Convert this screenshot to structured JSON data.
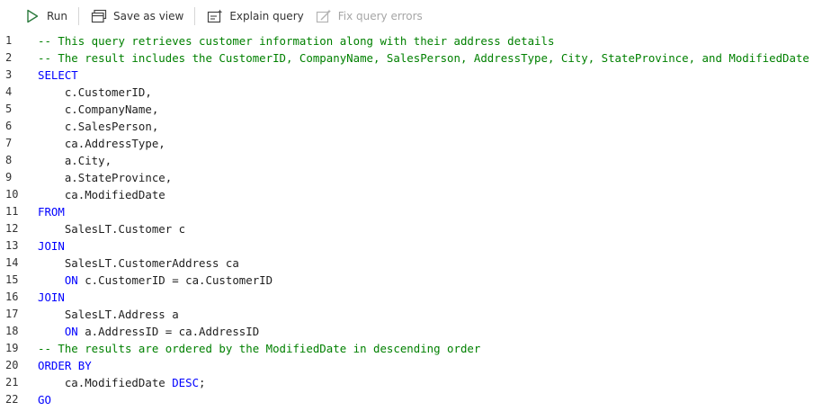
{
  "toolbar": {
    "run_label": "Run",
    "save_view_label": "Save as view",
    "explain_label": "Explain query",
    "fix_label": "Fix query errors"
  },
  "colors": {
    "comment": "#008000",
    "keyword": "#0000ff",
    "text": "#1f1f1f",
    "disabled": "#a6a6a6"
  },
  "editor": {
    "lines": [
      {
        "num": "1",
        "tokens": [
          {
            "t": "-- This query retrieves customer information along with their address details",
            "k": "comment"
          }
        ]
      },
      {
        "num": "2",
        "tokens": [
          {
            "t": "-- The result includes the CustomerID, CompanyName, SalesPerson, AddressType, City, StateProvince, and ModifiedDate",
            "k": "comment"
          }
        ]
      },
      {
        "num": "3",
        "tokens": [
          {
            "t": "SELECT",
            "k": "keyword"
          }
        ]
      },
      {
        "num": "4",
        "tokens": [
          {
            "t": "    c.CustomerID,",
            "k": "text"
          }
        ]
      },
      {
        "num": "5",
        "tokens": [
          {
            "t": "    c.CompanyName,",
            "k": "text"
          }
        ]
      },
      {
        "num": "6",
        "tokens": [
          {
            "t": "    c.SalesPerson,",
            "k": "text"
          }
        ]
      },
      {
        "num": "7",
        "tokens": [
          {
            "t": "    ca.AddressType,",
            "k": "text"
          }
        ]
      },
      {
        "num": "8",
        "tokens": [
          {
            "t": "    a.City,",
            "k": "text"
          }
        ]
      },
      {
        "num": "9",
        "tokens": [
          {
            "t": "    a.StateProvince,",
            "k": "text"
          }
        ]
      },
      {
        "num": "10",
        "tokens": [
          {
            "t": "    ca.ModifiedDate",
            "k": "text"
          }
        ]
      },
      {
        "num": "11",
        "tokens": [
          {
            "t": "FROM",
            "k": "keyword"
          }
        ]
      },
      {
        "num": "12",
        "tokens": [
          {
            "t": "    SalesLT.Customer c",
            "k": "text"
          }
        ]
      },
      {
        "num": "13",
        "tokens": [
          {
            "t": "JOIN",
            "k": "keyword"
          }
        ]
      },
      {
        "num": "14",
        "tokens": [
          {
            "t": "    SalesLT.CustomerAddress ca",
            "k": "text"
          }
        ]
      },
      {
        "num": "15",
        "tokens": [
          {
            "t": "    ",
            "k": "text"
          },
          {
            "t": "ON",
            "k": "keyword"
          },
          {
            "t": " c.CustomerID = ca.CustomerID",
            "k": "text"
          }
        ]
      },
      {
        "num": "16",
        "tokens": [
          {
            "t": "JOIN",
            "k": "keyword"
          }
        ]
      },
      {
        "num": "17",
        "tokens": [
          {
            "t": "    SalesLT.Address a",
            "k": "text"
          }
        ]
      },
      {
        "num": "18",
        "tokens": [
          {
            "t": "    ",
            "k": "text"
          },
          {
            "t": "ON",
            "k": "keyword"
          },
          {
            "t": " a.AddressID = ca.AddressID",
            "k": "text"
          }
        ]
      },
      {
        "num": "19",
        "tokens": [
          {
            "t": "-- The results are ordered by the ModifiedDate in descending order",
            "k": "comment"
          }
        ]
      },
      {
        "num": "20",
        "tokens": [
          {
            "t": "ORDER BY",
            "k": "keyword"
          }
        ]
      },
      {
        "num": "21",
        "tokens": [
          {
            "t": "    ca.ModifiedDate ",
            "k": "text"
          },
          {
            "t": "DESC",
            "k": "keyword"
          },
          {
            "t": ";",
            "k": "text"
          }
        ]
      },
      {
        "num": "22",
        "tokens": [
          {
            "t": "GO",
            "k": "keyword"
          }
        ]
      }
    ]
  }
}
